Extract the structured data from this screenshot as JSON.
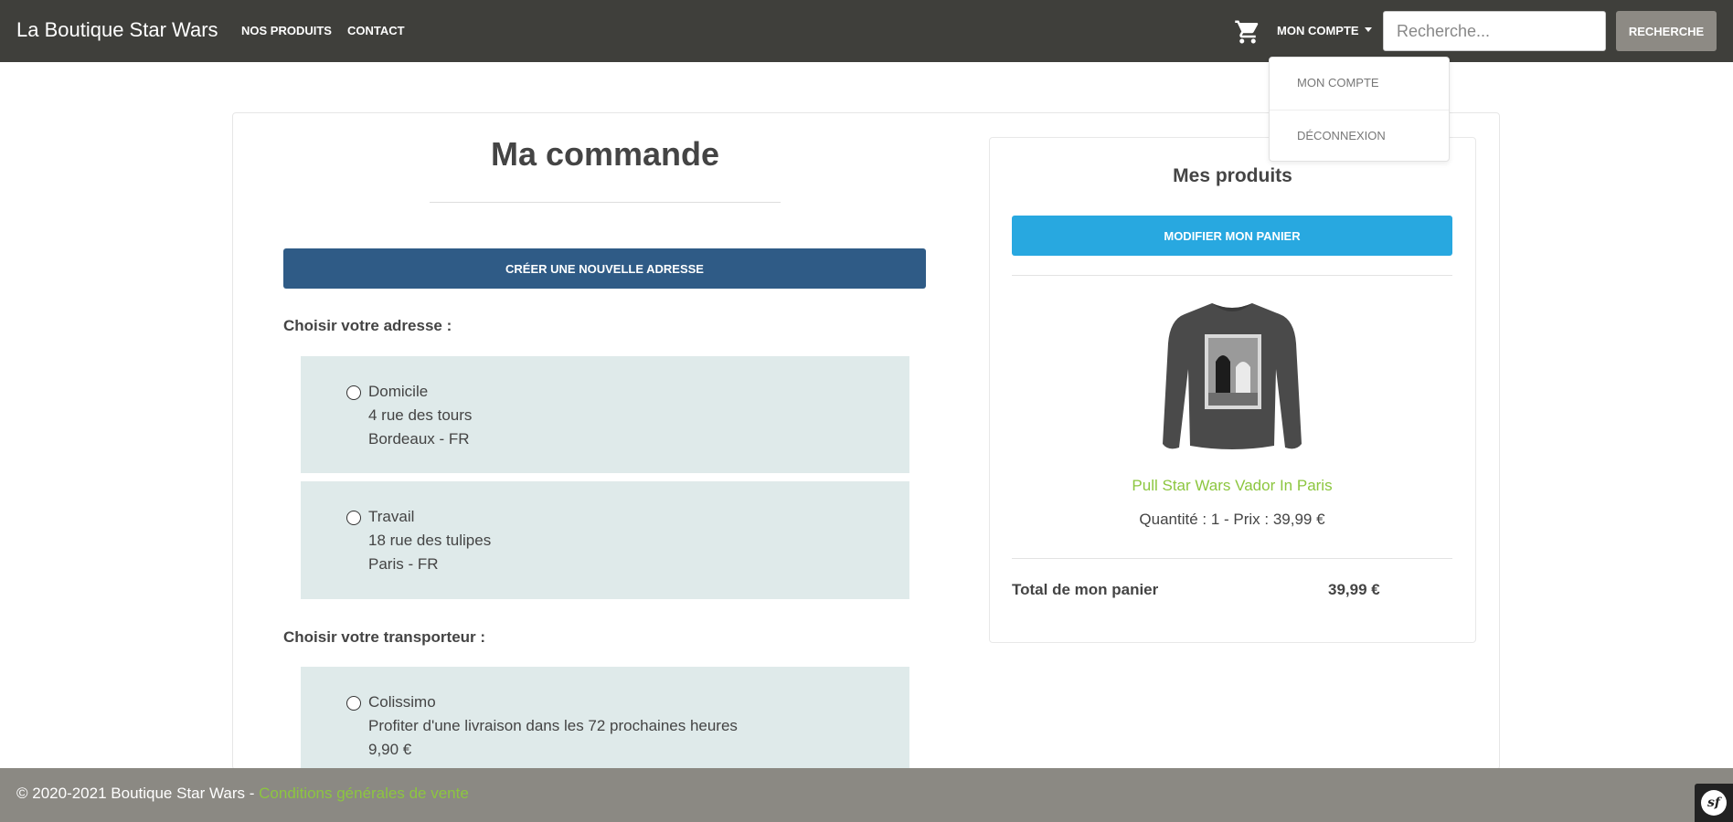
{
  "header": {
    "brand": "La Boutique Star Wars",
    "nav": [
      "NOS PRODUITS",
      "CONTACT"
    ],
    "account_label": "MON COMPTE",
    "search_placeholder": "Recherche...",
    "search_button": "RECHERCHE",
    "cart_icon": "cart-icon"
  },
  "account_menu": {
    "items": [
      "MON COMPTE",
      "DÉCONNEXION"
    ]
  },
  "order": {
    "title": "Ma commande",
    "new_address_button": "CRÉER UNE NOUVELLE ADRESSE",
    "address_label": "Choisir votre adresse :",
    "addresses": [
      {
        "name": "Domicile",
        "street": "4 rue des tours",
        "city": "Bordeaux - FR"
      },
      {
        "name": "Travail",
        "street": "18 rue des tulipes",
        "city": "Paris - FR"
      }
    ],
    "carrier_label": "Choisir votre transporteur :",
    "carriers": [
      {
        "name": "Colissimo",
        "description": "Profiter d'une livraison dans les 72 prochaines heures",
        "price": "9,90 €"
      }
    ]
  },
  "cart": {
    "title": "Mes produits",
    "edit_button": "MODIFIER MON PANIER",
    "product_name": "Pull Star Wars Vador In Paris",
    "product_qty_price": "Quantité : 1 - Prix : 39,99 €",
    "total_label": "Total de mon panier",
    "total_value": "39,99 €"
  },
  "footer": {
    "copyright": "© 2020-2021 Boutique Star Wars - ",
    "terms_link": "Conditions générales de vente"
  },
  "colors": {
    "navbar": "#3f3f3b",
    "primary_button": "#2f5b86",
    "cart_button": "#28a8e0",
    "option_bg": "#dfeaea",
    "accent_green": "#8cc63f",
    "footer": "#8b8983"
  }
}
